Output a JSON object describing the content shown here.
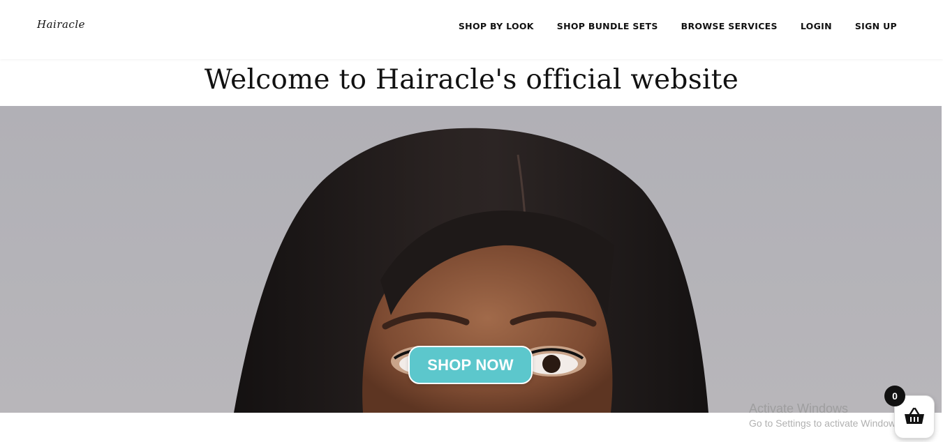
{
  "header": {
    "logo": "Hairacle",
    "nav": [
      {
        "label": "SHOP BY LOOK"
      },
      {
        "label": "SHOP BUNDLE SETS"
      },
      {
        "label": "BROWSE SERVICES"
      },
      {
        "label": "LOGIN"
      },
      {
        "label": "SIGN UP"
      }
    ]
  },
  "main": {
    "welcome_title": "Welcome to Hairacle's official website",
    "hero": {
      "cta_label": "SHOP NOW"
    }
  },
  "cart": {
    "count": "0",
    "icon": "basket-icon"
  },
  "watermark": {
    "title": "Activate Windows",
    "subtitle": "Go to Settings to activate Windows."
  },
  "colors": {
    "accent": "#5cc7cc",
    "hero_bg": "#b2b1b6",
    "text": "#111111"
  }
}
